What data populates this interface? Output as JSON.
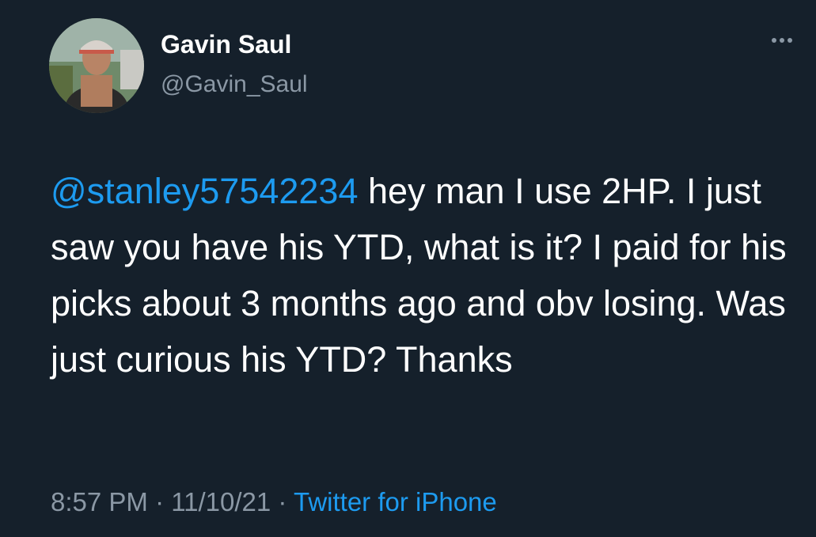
{
  "author": {
    "display_name": "Gavin Saul",
    "handle": "@Gavin_Saul"
  },
  "tweet": {
    "mention": "@stanley57542234",
    "text": " hey man I use 2HP. I just saw you have his YTD, what is it? I paid for his picks about 3 months ago and obv losing. Was just curious his YTD? Thanks",
    "time": "8:57 PM",
    "date": "11/10/21",
    "separator": " · ",
    "source": "Twitter for iPhone"
  },
  "icons": {
    "more": "more-horizontal-icon"
  },
  "colors": {
    "background": "#15202b",
    "text": "#ffffff",
    "secondary": "#8b98a5",
    "accent": "#1d9bf0"
  }
}
